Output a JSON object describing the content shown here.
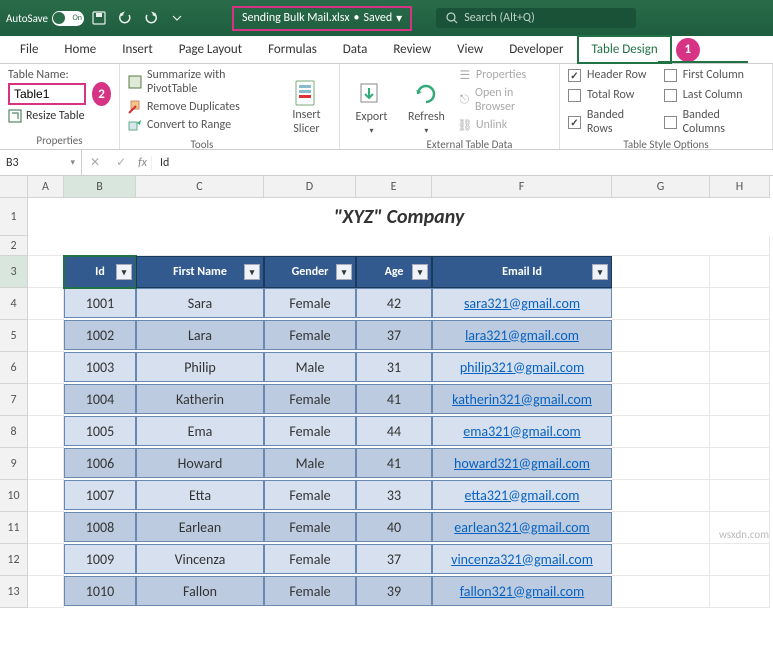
{
  "titlebar": {
    "autosave_label": "AutoSave",
    "autosave_state": "On",
    "filename": "Sending Bulk Mail.xlsx",
    "save_status": "Saved",
    "search_placeholder": "Search (Alt+Q)"
  },
  "tabs": {
    "file": "File",
    "home": "Home",
    "insert": "Insert",
    "page_layout": "Page Layout",
    "formulas": "Formulas",
    "data": "Data",
    "review": "Review",
    "view": "View",
    "developer": "Developer",
    "table_design": "Table Design"
  },
  "badges": {
    "design": "1",
    "tablename": "2"
  },
  "ribbon": {
    "properties": {
      "table_name_label": "Table Name:",
      "table_name_value": "Table1",
      "resize_table": "Resize Table",
      "group_label": "Properties"
    },
    "tools": {
      "summarize": "Summarize with PivotTable",
      "remove_dup": "Remove Duplicates",
      "convert": "Convert to Range",
      "slicer": "Insert\nSlicer",
      "group_label": "Tools"
    },
    "external": {
      "export": "Export",
      "refresh": "Refresh",
      "properties": "Properties",
      "open_browser": "Open in Browser",
      "unlink": "Unlink",
      "group_label": "External Table Data"
    },
    "style_options": {
      "header_row": "Header Row",
      "total_row": "Total Row",
      "banded_rows": "Banded Rows",
      "first_col": "First Column",
      "last_col": "Last Column",
      "banded_cols": "Banded Columns",
      "group_label": "Table Style Options"
    }
  },
  "formula_bar": {
    "name_box": "B3",
    "formula": "Id"
  },
  "columns": [
    "A",
    "B",
    "C",
    "D",
    "E",
    "F",
    "G",
    "H"
  ],
  "sheet": {
    "company_title": "\"XYZ\" Company",
    "headers": {
      "id": "Id",
      "first_name": "First Name",
      "gender": "Gender",
      "age": "Age",
      "email": "Email Id"
    },
    "rows": [
      {
        "id": "1001",
        "first": "Sara",
        "gender": "Female",
        "age": "42",
        "email": "sara321@gmail.com"
      },
      {
        "id": "1002",
        "first": "Lara",
        "gender": "Female",
        "age": "37",
        "email": "lara321@gmail.com"
      },
      {
        "id": "1003",
        "first": "Philip",
        "gender": "Male",
        "age": "31",
        "email": "philip321@gmail.com"
      },
      {
        "id": "1004",
        "first": "Katherin",
        "gender": "Female",
        "age": "41",
        "email": "katherin321@gmail.com"
      },
      {
        "id": "1005",
        "first": "Ema",
        "gender": "Female",
        "age": "44",
        "email": "ema321@gmail.com"
      },
      {
        "id": "1006",
        "first": "Howard",
        "gender": "Male",
        "age": "41",
        "email": "howard321@gmail.com"
      },
      {
        "id": "1007",
        "first": "Etta",
        "gender": "Female",
        "age": "33",
        "email": "etta321@gmail.com"
      },
      {
        "id": "1008",
        "first": "Earlean",
        "gender": "Female",
        "age": "40",
        "email": "earlean321@gmail.com"
      },
      {
        "id": "1009",
        "first": "Vincenza",
        "gender": "Female",
        "age": "37",
        "email": "vincenza321@gmail.com"
      },
      {
        "id": "1010",
        "first": "Fallon",
        "gender": "Female",
        "age": "39",
        "email": "fallon321@gmail.com"
      }
    ]
  },
  "watermark": "wsxdn.com"
}
